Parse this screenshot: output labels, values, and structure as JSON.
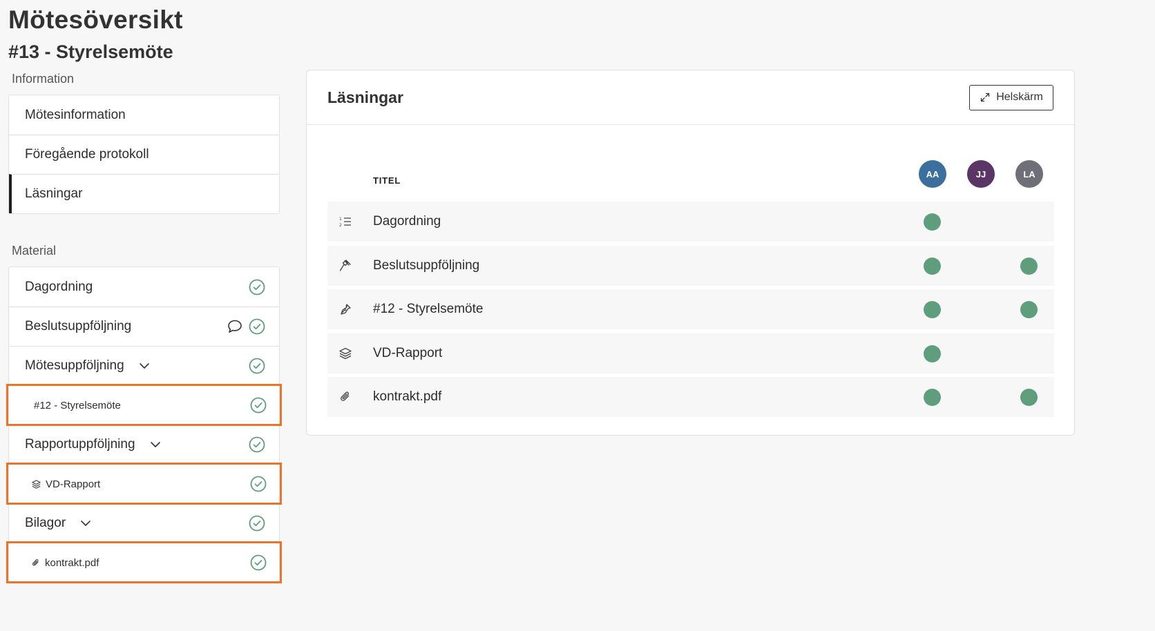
{
  "page": {
    "title": "Mötesöversikt",
    "subtitle": "#13 - Styrelsemöte"
  },
  "sidebar": {
    "information_label": "Information",
    "information_items": [
      {
        "label": "Mötesinformation",
        "active": false
      },
      {
        "label": "Föregående protokoll",
        "active": false
      },
      {
        "label": "Läsningar",
        "active": true
      }
    ],
    "material_label": "Material",
    "material_items": [
      {
        "label": "Dagordning",
        "status": "check-icon"
      },
      {
        "label": "Beslutsuppföljning",
        "status": "check-icon",
        "extra_icon": "comment-icon"
      },
      {
        "label": "Mötesuppföljning",
        "status": "check-icon",
        "expandable": true
      },
      {
        "label": "#12 - Styrelsemöte",
        "status": "check-icon",
        "sub": true,
        "highlighted": true
      },
      {
        "label": "Rapportuppföljning",
        "status": "check-icon",
        "expandable": true
      },
      {
        "label": "VD-Rapport",
        "status": "check-icon",
        "sub": true,
        "icon": "layers-icon",
        "highlighted": true
      },
      {
        "label": "Bilagor",
        "status": "check-icon",
        "expandable": true
      },
      {
        "label": "kontrakt.pdf",
        "status": "check-icon",
        "sub": true,
        "icon": "paperclip-icon",
        "highlighted": true
      }
    ]
  },
  "panel": {
    "title": "Läsningar",
    "fullscreen_label": "Helskärm",
    "column_title": "TITEL",
    "readers": [
      {
        "initials": "AA",
        "color": "#3a6f9e"
      },
      {
        "initials": "JJ",
        "color": "#5b3566"
      },
      {
        "initials": "LA",
        "color": "#6f6f78"
      }
    ],
    "rows": [
      {
        "title": "Dagordning",
        "icon": "numbered-list-icon",
        "read": [
          true,
          false,
          false
        ]
      },
      {
        "title": "Beslutsuppföljning",
        "icon": "gavel-icon",
        "read": [
          true,
          false,
          true
        ]
      },
      {
        "title": "#12 - Styrelsemöte",
        "icon": "pen-nib-icon",
        "read": [
          true,
          false,
          true
        ]
      },
      {
        "title": "VD-Rapport",
        "icon": "layers-icon",
        "read": [
          true,
          false,
          false
        ]
      },
      {
        "title": "kontrakt.pdf",
        "icon": "paperclip-icon",
        "read": [
          true,
          false,
          true
        ]
      }
    ]
  },
  "colors": {
    "accent_highlight": "#e8752a",
    "read_dot": "#5f9e7d",
    "check": "#5f9e7d"
  }
}
